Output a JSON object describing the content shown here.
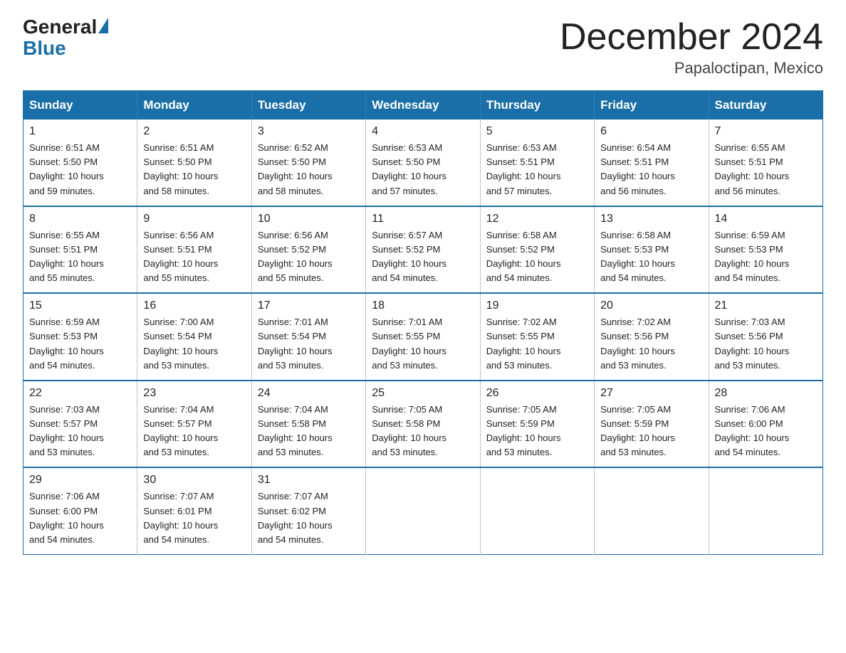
{
  "logo": {
    "general": "General",
    "blue": "Blue"
  },
  "header": {
    "month": "December 2024",
    "location": "Papaloctipan, Mexico"
  },
  "days_of_week": [
    "Sunday",
    "Monday",
    "Tuesday",
    "Wednesday",
    "Thursday",
    "Friday",
    "Saturday"
  ],
  "weeks": [
    [
      {
        "day": "1",
        "sunrise": "6:51 AM",
        "sunset": "5:50 PM",
        "daylight": "10 hours and 59 minutes."
      },
      {
        "day": "2",
        "sunrise": "6:51 AM",
        "sunset": "5:50 PM",
        "daylight": "10 hours and 58 minutes."
      },
      {
        "day": "3",
        "sunrise": "6:52 AM",
        "sunset": "5:50 PM",
        "daylight": "10 hours and 58 minutes."
      },
      {
        "day": "4",
        "sunrise": "6:53 AM",
        "sunset": "5:50 PM",
        "daylight": "10 hours and 57 minutes."
      },
      {
        "day": "5",
        "sunrise": "6:53 AM",
        "sunset": "5:51 PM",
        "daylight": "10 hours and 57 minutes."
      },
      {
        "day": "6",
        "sunrise": "6:54 AM",
        "sunset": "5:51 PM",
        "daylight": "10 hours and 56 minutes."
      },
      {
        "day": "7",
        "sunrise": "6:55 AM",
        "sunset": "5:51 PM",
        "daylight": "10 hours and 56 minutes."
      }
    ],
    [
      {
        "day": "8",
        "sunrise": "6:55 AM",
        "sunset": "5:51 PM",
        "daylight": "10 hours and 55 minutes."
      },
      {
        "day": "9",
        "sunrise": "6:56 AM",
        "sunset": "5:51 PM",
        "daylight": "10 hours and 55 minutes."
      },
      {
        "day": "10",
        "sunrise": "6:56 AM",
        "sunset": "5:52 PM",
        "daylight": "10 hours and 55 minutes."
      },
      {
        "day": "11",
        "sunrise": "6:57 AM",
        "sunset": "5:52 PM",
        "daylight": "10 hours and 54 minutes."
      },
      {
        "day": "12",
        "sunrise": "6:58 AM",
        "sunset": "5:52 PM",
        "daylight": "10 hours and 54 minutes."
      },
      {
        "day": "13",
        "sunrise": "6:58 AM",
        "sunset": "5:53 PM",
        "daylight": "10 hours and 54 minutes."
      },
      {
        "day": "14",
        "sunrise": "6:59 AM",
        "sunset": "5:53 PM",
        "daylight": "10 hours and 54 minutes."
      }
    ],
    [
      {
        "day": "15",
        "sunrise": "6:59 AM",
        "sunset": "5:53 PM",
        "daylight": "10 hours and 54 minutes."
      },
      {
        "day": "16",
        "sunrise": "7:00 AM",
        "sunset": "5:54 PM",
        "daylight": "10 hours and 53 minutes."
      },
      {
        "day": "17",
        "sunrise": "7:01 AM",
        "sunset": "5:54 PM",
        "daylight": "10 hours and 53 minutes."
      },
      {
        "day": "18",
        "sunrise": "7:01 AM",
        "sunset": "5:55 PM",
        "daylight": "10 hours and 53 minutes."
      },
      {
        "day": "19",
        "sunrise": "7:02 AM",
        "sunset": "5:55 PM",
        "daylight": "10 hours and 53 minutes."
      },
      {
        "day": "20",
        "sunrise": "7:02 AM",
        "sunset": "5:56 PM",
        "daylight": "10 hours and 53 minutes."
      },
      {
        "day": "21",
        "sunrise": "7:03 AM",
        "sunset": "5:56 PM",
        "daylight": "10 hours and 53 minutes."
      }
    ],
    [
      {
        "day": "22",
        "sunrise": "7:03 AM",
        "sunset": "5:57 PM",
        "daylight": "10 hours and 53 minutes."
      },
      {
        "day": "23",
        "sunrise": "7:04 AM",
        "sunset": "5:57 PM",
        "daylight": "10 hours and 53 minutes."
      },
      {
        "day": "24",
        "sunrise": "7:04 AM",
        "sunset": "5:58 PM",
        "daylight": "10 hours and 53 minutes."
      },
      {
        "day": "25",
        "sunrise": "7:05 AM",
        "sunset": "5:58 PM",
        "daylight": "10 hours and 53 minutes."
      },
      {
        "day": "26",
        "sunrise": "7:05 AM",
        "sunset": "5:59 PM",
        "daylight": "10 hours and 53 minutes."
      },
      {
        "day": "27",
        "sunrise": "7:05 AM",
        "sunset": "5:59 PM",
        "daylight": "10 hours and 53 minutes."
      },
      {
        "day": "28",
        "sunrise": "7:06 AM",
        "sunset": "6:00 PM",
        "daylight": "10 hours and 54 minutes."
      }
    ],
    [
      {
        "day": "29",
        "sunrise": "7:06 AM",
        "sunset": "6:00 PM",
        "daylight": "10 hours and 54 minutes."
      },
      {
        "day": "30",
        "sunrise": "7:07 AM",
        "sunset": "6:01 PM",
        "daylight": "10 hours and 54 minutes."
      },
      {
        "day": "31",
        "sunrise": "7:07 AM",
        "sunset": "6:02 PM",
        "daylight": "10 hours and 54 minutes."
      },
      null,
      null,
      null,
      null
    ]
  ],
  "labels": {
    "sunrise": "Sunrise:",
    "sunset": "Sunset:",
    "daylight": "Daylight:"
  }
}
